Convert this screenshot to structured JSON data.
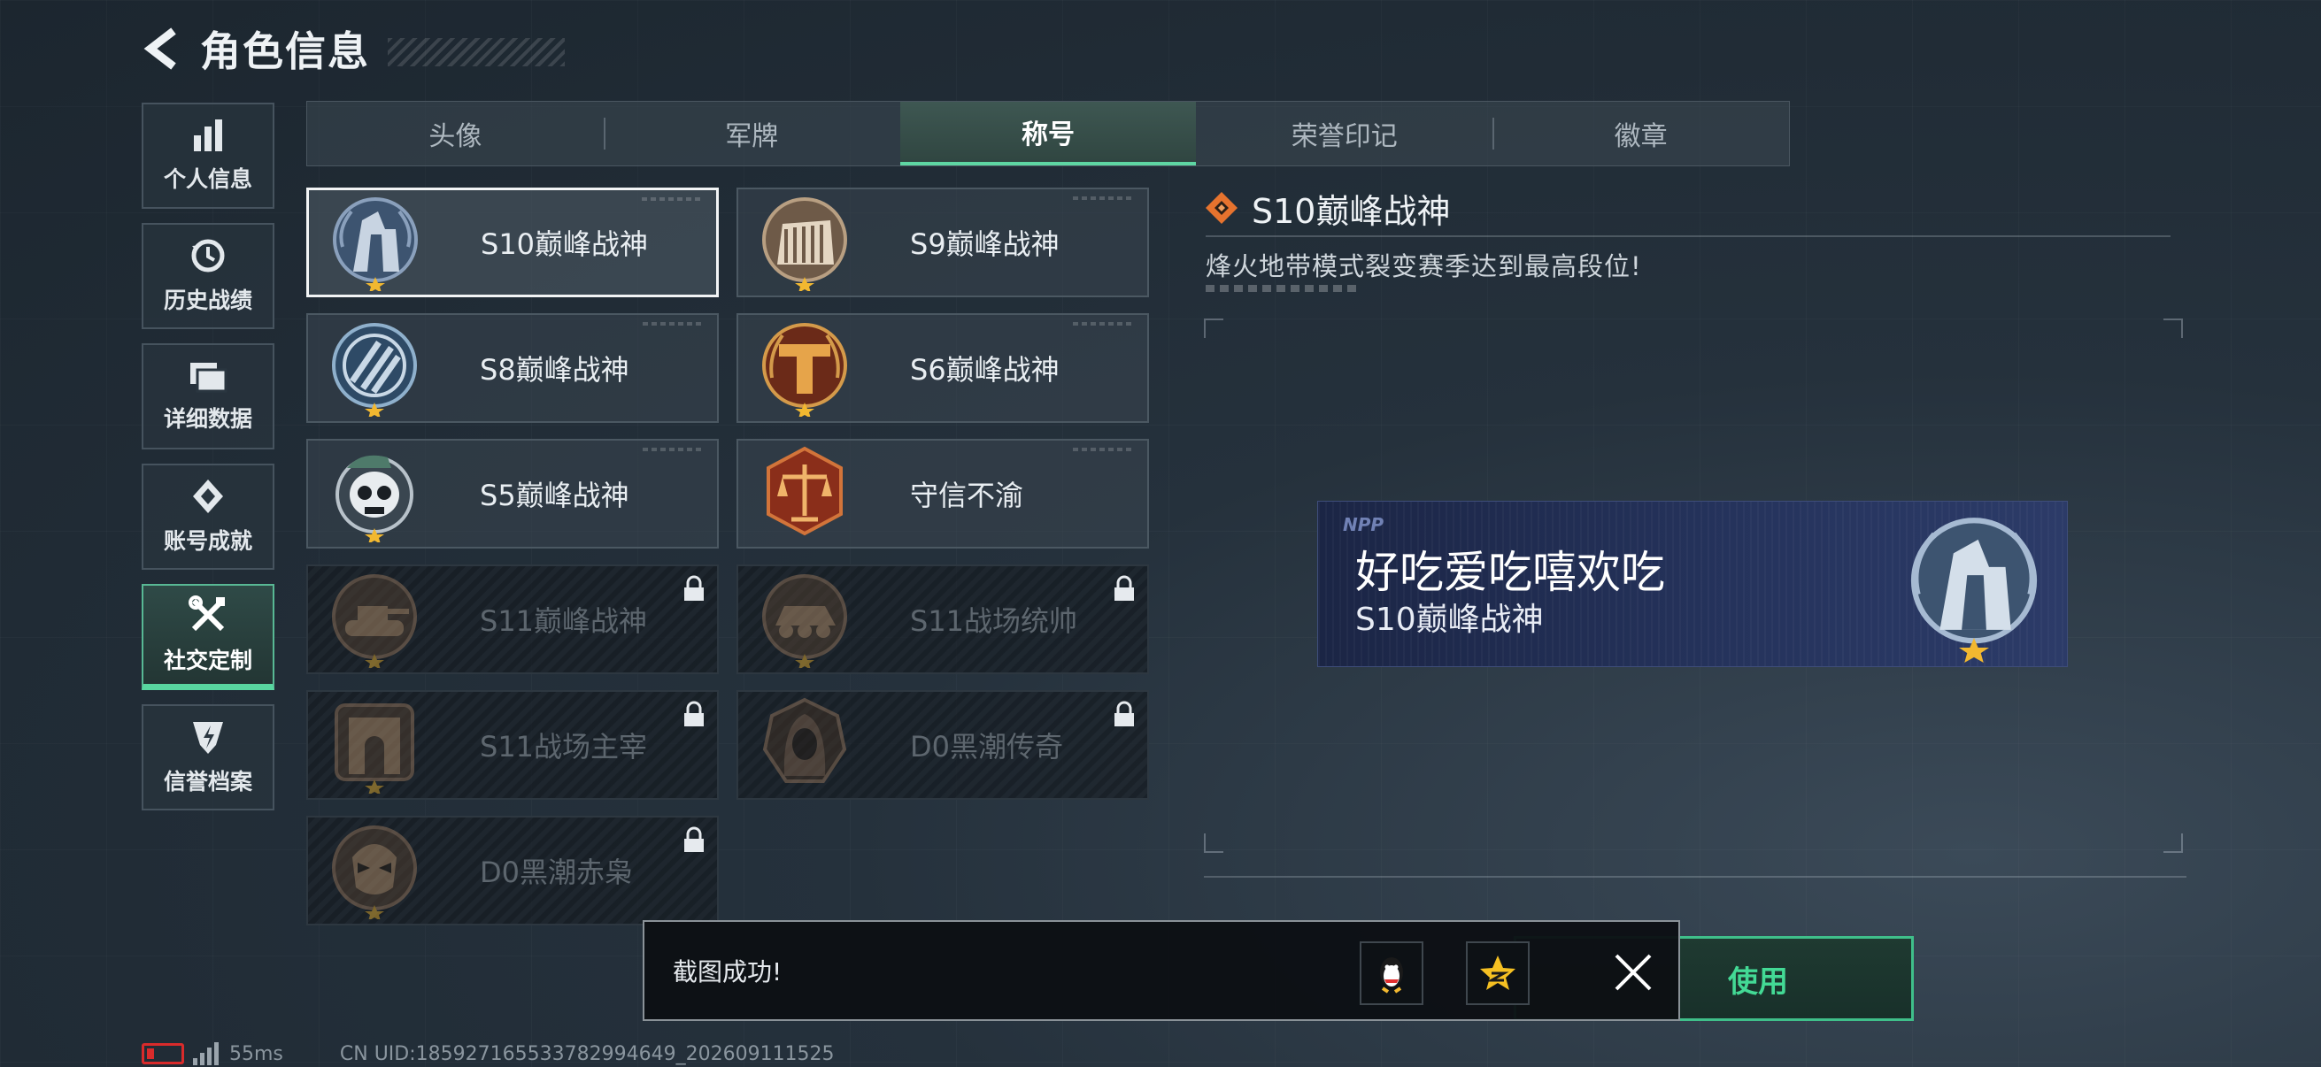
{
  "header": {
    "title": "角色信息"
  },
  "sidebar": {
    "items": [
      {
        "label": "个人信息",
        "icon": "bar-chart-icon"
      },
      {
        "label": "历史战绩",
        "icon": "history-clock-icon"
      },
      {
        "label": "详细数据",
        "icon": "folder-icon"
      },
      {
        "label": "账号成就",
        "icon": "achievement-icon"
      },
      {
        "label": "社交定制",
        "icon": "tools-icon",
        "active": true
      },
      {
        "label": "信誉档案",
        "icon": "credit-shield-icon"
      }
    ]
  },
  "tabs": [
    {
      "label": "头像"
    },
    {
      "label": "军牌"
    },
    {
      "label": "称号",
      "active": true
    },
    {
      "label": "荣誉印记"
    },
    {
      "label": "徽章"
    }
  ],
  "titles": [
    {
      "label": "S10巅峰战神",
      "locked": false,
      "selected": true,
      "emblem": "tower-emblem-icon"
    },
    {
      "label": "S9巅峰战神",
      "locked": false,
      "emblem": "dam-emblem-icon"
    },
    {
      "label": "S8巅峰战神",
      "locked": false,
      "emblem": "striped-emblem-icon"
    },
    {
      "label": "S6巅峰战神",
      "locked": false,
      "emblem": "t-emblem-icon"
    },
    {
      "label": "S5巅峰战神",
      "locked": false,
      "emblem": "skull-emblem-icon"
    },
    {
      "label": "守信不渝",
      "locked": false,
      "emblem": "scales-emblem-icon"
    },
    {
      "label": "S11巅峰战神",
      "locked": true,
      "emblem": "tank-emblem-icon"
    },
    {
      "label": "S11战场统帅",
      "locked": true,
      "emblem": "vehicle-emblem-icon"
    },
    {
      "label": "S11战场主宰",
      "locked": true,
      "emblem": "arch-emblem-icon"
    },
    {
      "label": "D0黑潮传奇",
      "locked": true,
      "emblem": "hooded-emblem-icon"
    },
    {
      "label": "D0黑潮赤枭",
      "locked": true,
      "emblem": "skull-mask-emblem-icon"
    }
  ],
  "detail": {
    "name": "S10巅峰战神",
    "description": "烽火地带模式裂变赛季达到最高段位!"
  },
  "nameplate": {
    "logo": "NPP",
    "player_name": "好吃爱吃嘻欢吃",
    "title": "S10巅峰战神"
  },
  "use_button": {
    "label": "使用"
  },
  "toast": {
    "message": "截图成功!",
    "share_targets": [
      "qq-penguin-icon",
      "qzone-star-icon"
    ]
  },
  "footer": {
    "ping": "55ms",
    "uid": "CN UID:185927165533782994649_202609111525"
  },
  "colors": {
    "accent_green": "#58d69f",
    "battery_red": "#d92b2b",
    "star_gold": "#f2b830",
    "nameplate_blue": "#25335c"
  }
}
